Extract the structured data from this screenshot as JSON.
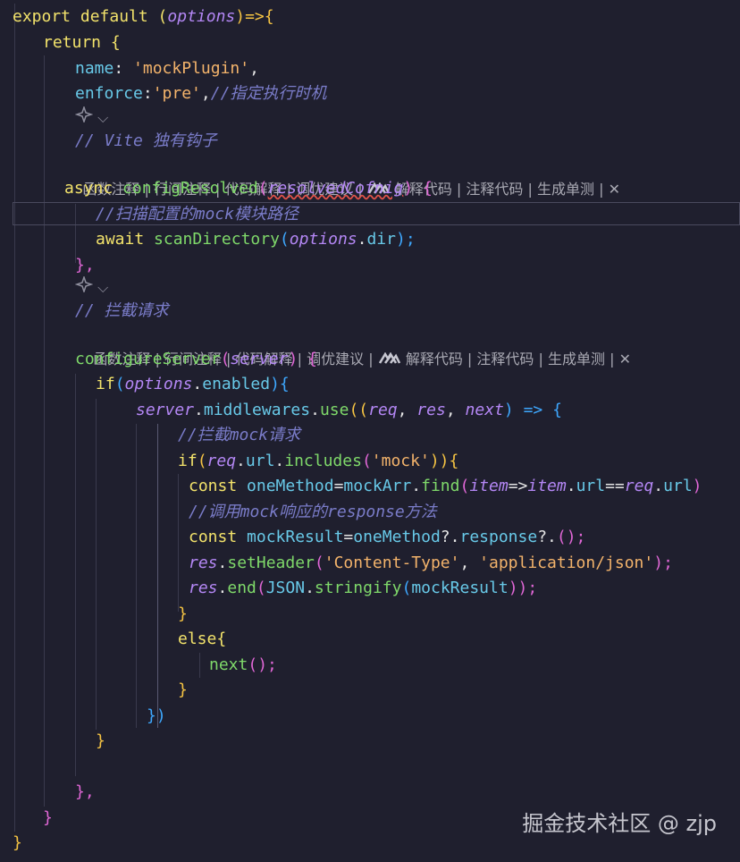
{
  "code": {
    "l1": [
      "export default (",
      "options",
      ")=>{"
    ],
    "l2": [
      "return {"
    ],
    "l3": [
      "name",
      ": ",
      "'mockPlugin'",
      ","
    ],
    "l4": [
      "enforce",
      ":",
      "'pre'",
      ",",
      "//指定执行时机"
    ],
    "l6": [
      "// Vite 独有钩子"
    ],
    "l8": [
      "async ",
      "configResolved",
      "(",
      "resolvedCofnig",
      ") {"
    ],
    "l9": [
      "//扫描配置的mock模块路径"
    ],
    "l10": [
      "await ",
      "scanDirectory",
      "(",
      "options",
      ".",
      "dir",
      ");"
    ],
    "l11": [
      "},"
    ],
    "l13": [
      "// 拦截请求"
    ],
    "l15": [
      "configureServer",
      "(",
      "server",
      ") {"
    ],
    "l16": [
      "if",
      "(",
      "options",
      ".",
      "enabled",
      "){"
    ],
    "l17": [
      "server",
      ".",
      "middlewares",
      ".",
      "use",
      "((",
      "req",
      ", ",
      "res",
      ", ",
      "next",
      ") => {"
    ],
    "l18": [
      "//拦截mock请求"
    ],
    "l19": [
      "if",
      "(",
      "req",
      ".",
      "url",
      ".",
      "includes",
      "(",
      "'mock'",
      ")){"
    ],
    "l20": [
      "const ",
      "oneMethod",
      "=",
      "mockArr",
      ".",
      "find",
      "(",
      "item",
      "=>",
      "item",
      ".",
      "url",
      "==",
      "req",
      ".",
      "url",
      ")"
    ],
    "l21": [
      "//调用mock响应的response方法"
    ],
    "l22": [
      "const ",
      "mockResult",
      "=",
      "oneMethod",
      "?.",
      "response",
      "?.",
      "();"
    ],
    "l23": [
      "res",
      ".",
      "setHeader",
      "(",
      "'Content-Type'",
      ", ",
      "'application/json'",
      ");"
    ],
    "l24": [
      "res",
      ".",
      "end",
      "(",
      "JSON",
      ".",
      "stringify",
      "(",
      "mockResult",
      "));"
    ],
    "l25": [
      "}"
    ],
    "l26": [
      "else{"
    ],
    "l27": [
      "next",
      "();"
    ],
    "l28": [
      "}"
    ],
    "l29": [
      "})"
    ],
    "l30": [
      "}"
    ],
    "l32": [
      "},"
    ],
    "l33": [
      "}"
    ],
    "l34": [
      "}"
    ]
  },
  "codelens": {
    "items": [
      "函数注释",
      "行间注释",
      "代码解释",
      "调优建议",
      "解释代码",
      "注释代码",
      "生成单测"
    ],
    "separator": "|",
    "close": "✕"
  },
  "ai_chevron": "⌵",
  "watermark": "掘金技术社区 @ zjp",
  "colors": {
    "background": "#1f1f2e",
    "keyword": "#f3e36b",
    "function": "#7fd96a",
    "property": "#68c9e8",
    "string": "#f3b36b",
    "parameter": "#b487f5",
    "comment": "#7a7cc9"
  }
}
